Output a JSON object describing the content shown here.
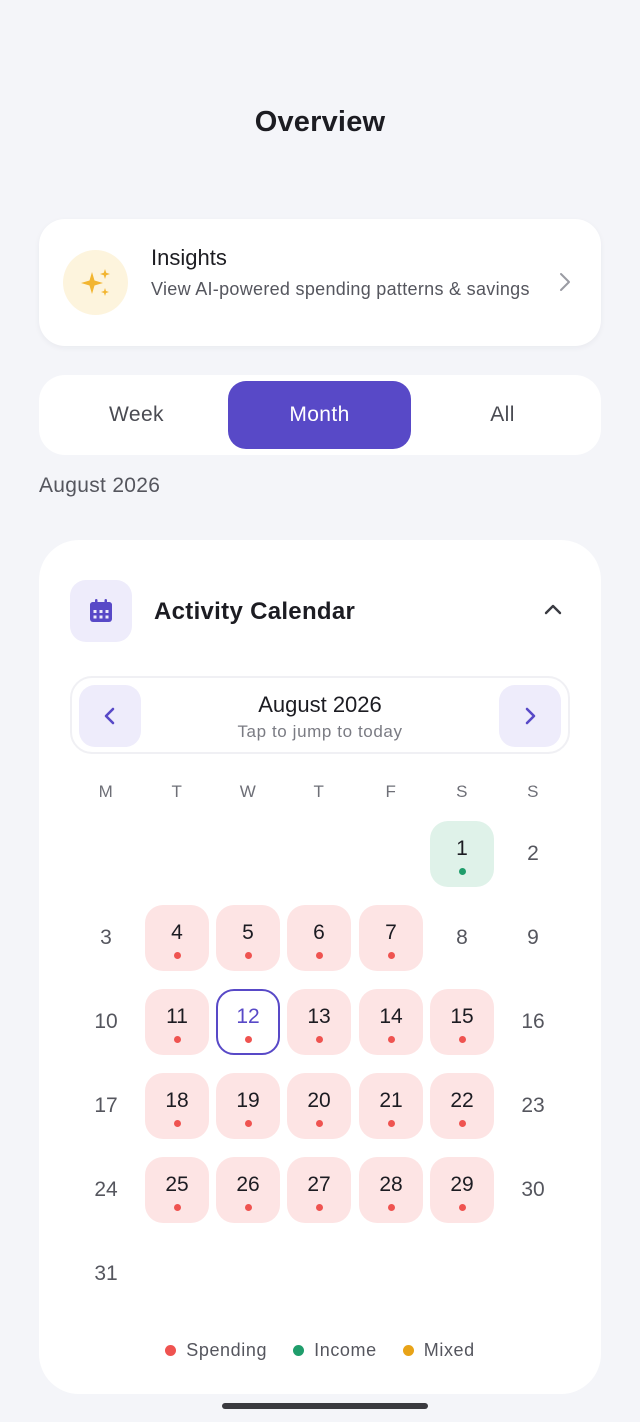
{
  "header": {
    "title": "Overview"
  },
  "insights": {
    "title": "Insights",
    "subtitle": "View AI-powered spending patterns & savings",
    "icon": "sparkles-icon",
    "accent": "#f2b531"
  },
  "segments": {
    "items": [
      {
        "label": "Week",
        "active": false
      },
      {
        "label": "Month",
        "active": true
      },
      {
        "label": "All",
        "active": false
      }
    ],
    "active_color": "#5849c7"
  },
  "period_label": "August 2026",
  "calendar": {
    "title": "Activity Calendar",
    "month_label": "August 2026",
    "hint": "Tap to jump to today",
    "weekdays": [
      "M",
      "T",
      "W",
      "T",
      "F",
      "S",
      "S"
    ],
    "days": [
      {
        "n": "1",
        "type": "income"
      },
      {
        "n": "2",
        "type": "none"
      },
      {
        "n": "3",
        "type": "none"
      },
      {
        "n": "4",
        "type": "spending"
      },
      {
        "n": "5",
        "type": "spending"
      },
      {
        "n": "6",
        "type": "spending"
      },
      {
        "n": "7",
        "type": "spending"
      },
      {
        "n": "8",
        "type": "none"
      },
      {
        "n": "9",
        "type": "none"
      },
      {
        "n": "10",
        "type": "none"
      },
      {
        "n": "11",
        "type": "spending"
      },
      {
        "n": "12",
        "type": "spending",
        "today": true
      },
      {
        "n": "13",
        "type": "spending"
      },
      {
        "n": "14",
        "type": "spending"
      },
      {
        "n": "15",
        "type": "spending"
      },
      {
        "n": "16",
        "type": "none"
      },
      {
        "n": "17",
        "type": "none"
      },
      {
        "n": "18",
        "type": "spending"
      },
      {
        "n": "19",
        "type": "spending"
      },
      {
        "n": "20",
        "type": "spending"
      },
      {
        "n": "21",
        "type": "spending"
      },
      {
        "n": "22",
        "type": "spending"
      },
      {
        "n": "23",
        "type": "none"
      },
      {
        "n": "24",
        "type": "none"
      },
      {
        "n": "25",
        "type": "spending"
      },
      {
        "n": "26",
        "type": "spending"
      },
      {
        "n": "27",
        "type": "spending"
      },
      {
        "n": "28",
        "type": "spending"
      },
      {
        "n": "29",
        "type": "spending"
      },
      {
        "n": "30",
        "type": "none"
      },
      {
        "n": "31",
        "type": "none"
      }
    ],
    "first_weekday_index": 5,
    "legend": [
      {
        "label": "Spending",
        "color": "#ef5350"
      },
      {
        "label": "Income",
        "color": "#1f9d6b"
      },
      {
        "label": "Mixed",
        "color": "#e8a317"
      }
    ]
  }
}
